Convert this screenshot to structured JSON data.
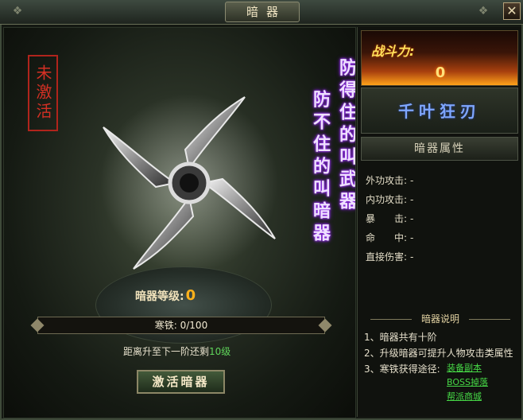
{
  "window": {
    "title": "暗器",
    "close_label": "✕"
  },
  "scene": {
    "stamp_text": "未激活",
    "slogan_line1": "防得住的叫武器",
    "slogan_line2": "防不住的叫暗器",
    "level_label": "暗器等级:",
    "level_value": "0",
    "progress_text": "寒铁: 0/100",
    "progress_fraction": 0,
    "next_prefix": "距离升至下一阶还剩",
    "next_level": "10级",
    "activate_label": "激活暗器"
  },
  "right": {
    "power_label": "战斗力:",
    "power_value": "0",
    "weapon_name": "千叶狂刃",
    "attr_header": "暗器属性",
    "attributes": [
      {
        "label": "外功攻击:",
        "value": "-"
      },
      {
        "label": "内功攻击:",
        "value": "-"
      },
      {
        "label": "暴　　击:",
        "value": "-"
      },
      {
        "label": "命　　中:",
        "value": "-"
      },
      {
        "label": "直接伤害:",
        "value": "-"
      }
    ],
    "explain_title": "暗器说明",
    "explain_lines": [
      "1、暗器共有十阶",
      "2、升级暗器可提升人物攻击类属性",
      "3、寒铁获得途径:"
    ],
    "links": [
      "装备副本",
      "BOSS掉落",
      "帮派商城"
    ]
  },
  "colors": {
    "accent_gold": "#ffb11b",
    "weapon_name_blue": "#7fa7ff",
    "link_green": "#46d846",
    "stamp_red": "#d43024",
    "slogan_glow": "#8a2be2"
  },
  "icons": {
    "close": "close-icon",
    "weapon": "shuriken-icon"
  }
}
